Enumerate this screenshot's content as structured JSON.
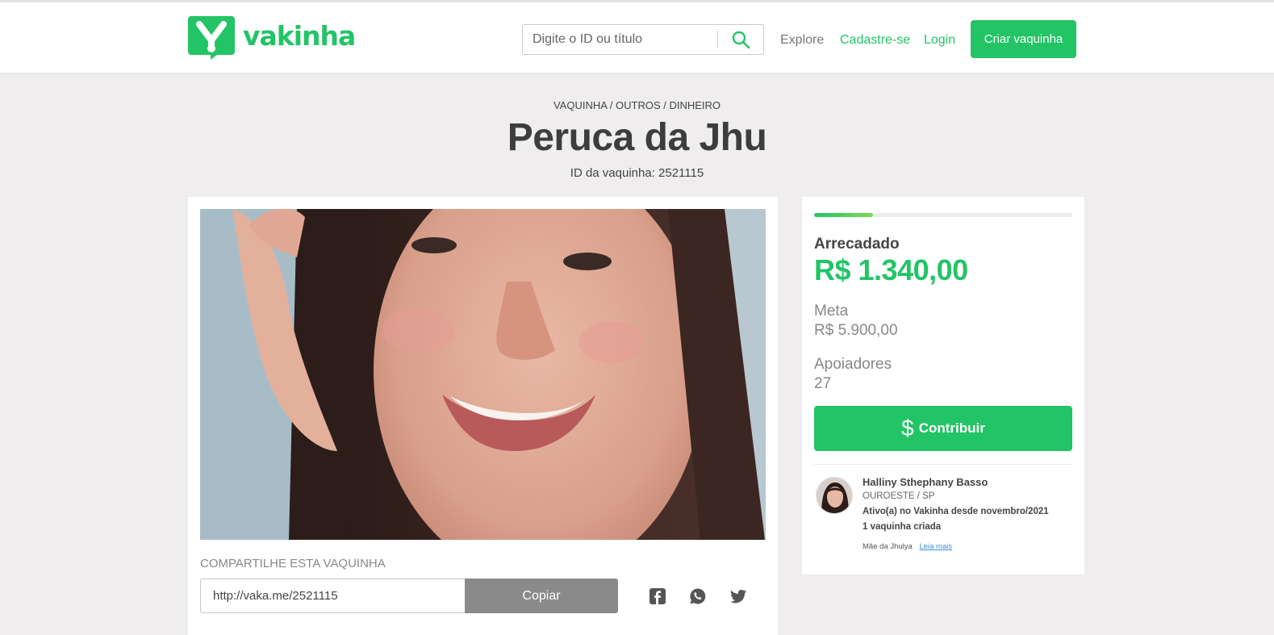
{
  "header": {
    "logo_text": "vakinha",
    "search_placeholder": "Digite o ID ou título",
    "nav": {
      "explore": "Explore",
      "cadastre": "Cadastre-se",
      "login": "Login"
    },
    "cta": "Criar vaquinha"
  },
  "campaign": {
    "breadcrumb": "VAQUINHA / OUTROS / DINHEIRO",
    "title": "Peruca da Jhu",
    "id_label": "ID da vaquinha: 2521115",
    "share_label": "COMPARTILHE ESTA VAQUINHA",
    "share_url": "http://vaka.me/2521115",
    "copy_label": "Copiar"
  },
  "stats": {
    "progress_fraction": 0.227,
    "raised_label": "Arrecadado",
    "raised_value": "R$ 1.340,00",
    "goal_label": "Meta",
    "goal_value": "R$ 5.900,00",
    "supporters_label": "Apoiadores",
    "supporters_value": "27",
    "contribute_symbol": "$",
    "contribute_label": "Contribuir"
  },
  "owner": {
    "name": "Halliny Sthephany Basso",
    "location": "OUROESTE / SP",
    "since": "Ativo(a) no Vakinha desde novembro/2021",
    "count": "1 vaquinha criada",
    "description": "Mãe da Jhulya",
    "read_more": "Leia mais"
  },
  "colors": {
    "brand": "#23c466",
    "background": "#efeded",
    "copy_button": "#8a8a8a"
  },
  "icons": [
    "vakinha-logo-icon",
    "search-icon",
    "dollar-icon",
    "facebook-icon",
    "whatsapp-icon",
    "twitter-icon"
  ]
}
